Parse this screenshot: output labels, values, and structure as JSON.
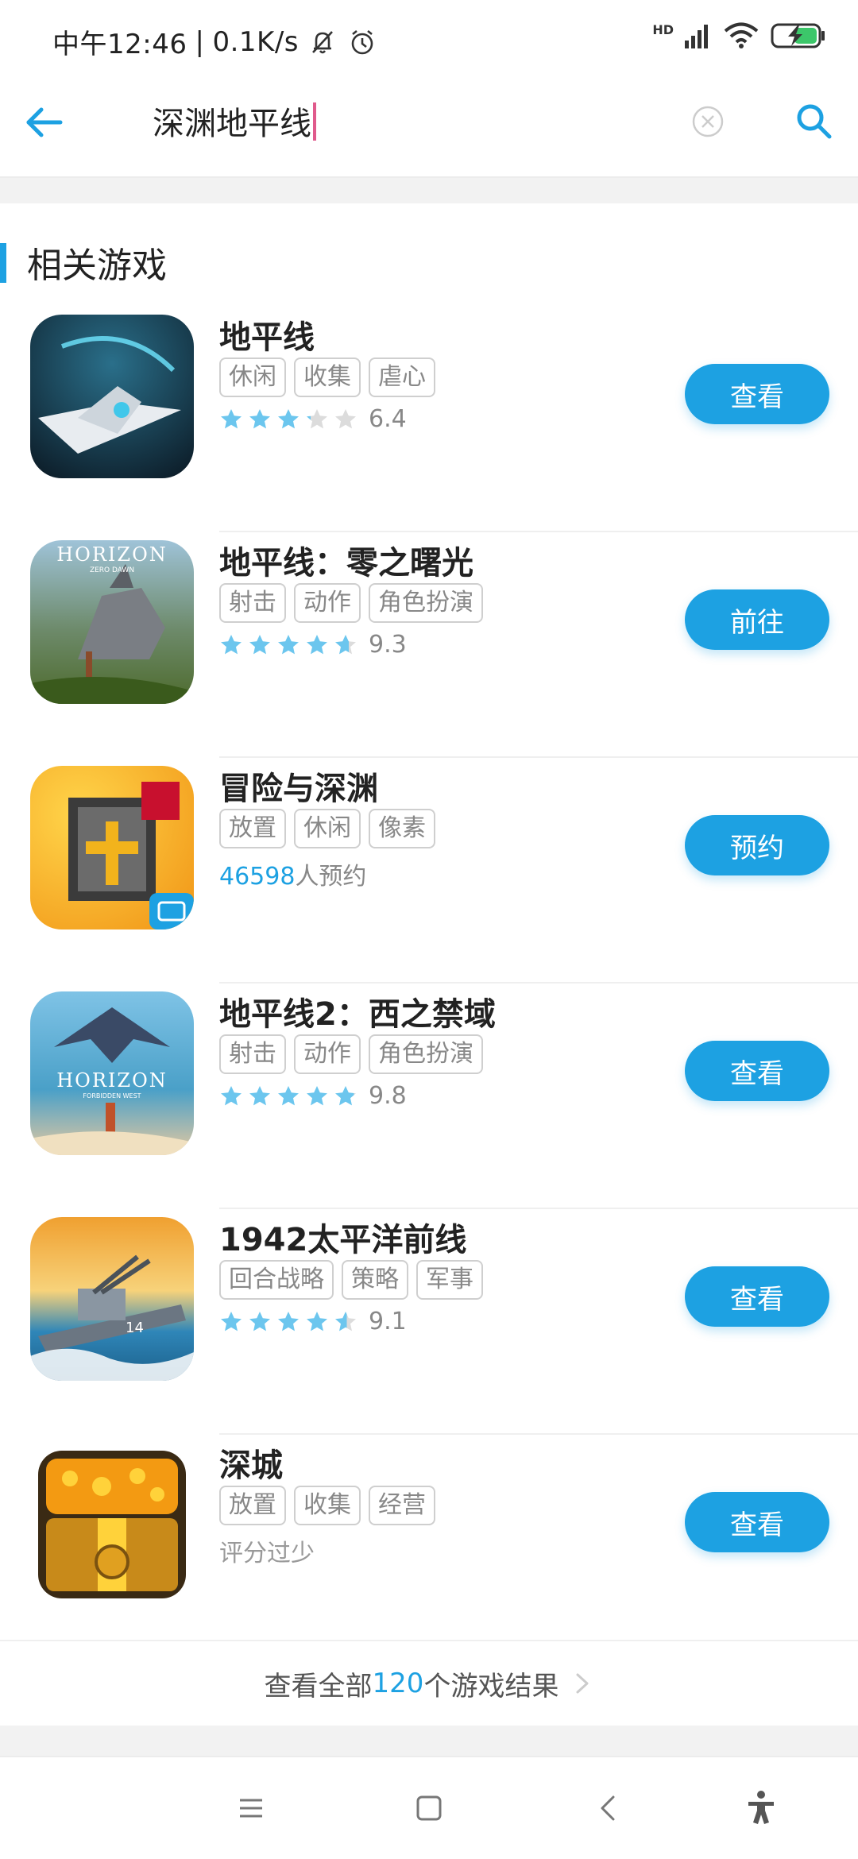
{
  "status": {
    "time": "中午12:46",
    "speed": "0.1K/s",
    "network": "HD"
  },
  "search": {
    "query": "深渊地平线"
  },
  "section": {
    "title": "相关游戏"
  },
  "games": [
    {
      "name": "地平线",
      "tags": [
        "休闲",
        "收集",
        "虐心"
      ],
      "rating": 6.4,
      "rating_text": "6.4",
      "button": "查看"
    },
    {
      "name": "地平线：零之曙光",
      "tags": [
        "射击",
        "动作",
        "角色扮演"
      ],
      "rating": 9.3,
      "rating_text": "9.3",
      "button": "前往"
    },
    {
      "name": "冒险与深渊",
      "tags": [
        "放置",
        "休闲",
        "像素"
      ],
      "reserve_count": "46598",
      "reserve_suffix": "人预约",
      "button": "预约"
    },
    {
      "name": "地平线2：西之禁域",
      "tags": [
        "射击",
        "动作",
        "角色扮演"
      ],
      "rating": 9.8,
      "rating_text": "9.8",
      "button": "查看"
    },
    {
      "name": "1942太平洋前线",
      "tags": [
        "回合战略",
        "策略",
        "军事"
      ],
      "rating": 9.1,
      "rating_text": "9.1",
      "button": "查看"
    },
    {
      "name": "深城",
      "tags": [
        "放置",
        "收集",
        "经营"
      ],
      "no_rating_text": "评分过少",
      "button": "查看"
    }
  ],
  "view_all": {
    "prefix": "查看全部",
    "count": "120",
    "suffix": "个游戏结果"
  },
  "icons": {
    "back": "arrow-left-icon",
    "clear": "clear-circle-icon",
    "search": "search-icon",
    "menu": "menu-icon",
    "home": "home-square-icon",
    "nav_back": "chevron-left-icon",
    "accessibility": "accessibility-icon"
  },
  "colors": {
    "accent": "#1da1e2",
    "star_on": "#6cc6ee",
    "star_off": "#dcdcdc"
  }
}
